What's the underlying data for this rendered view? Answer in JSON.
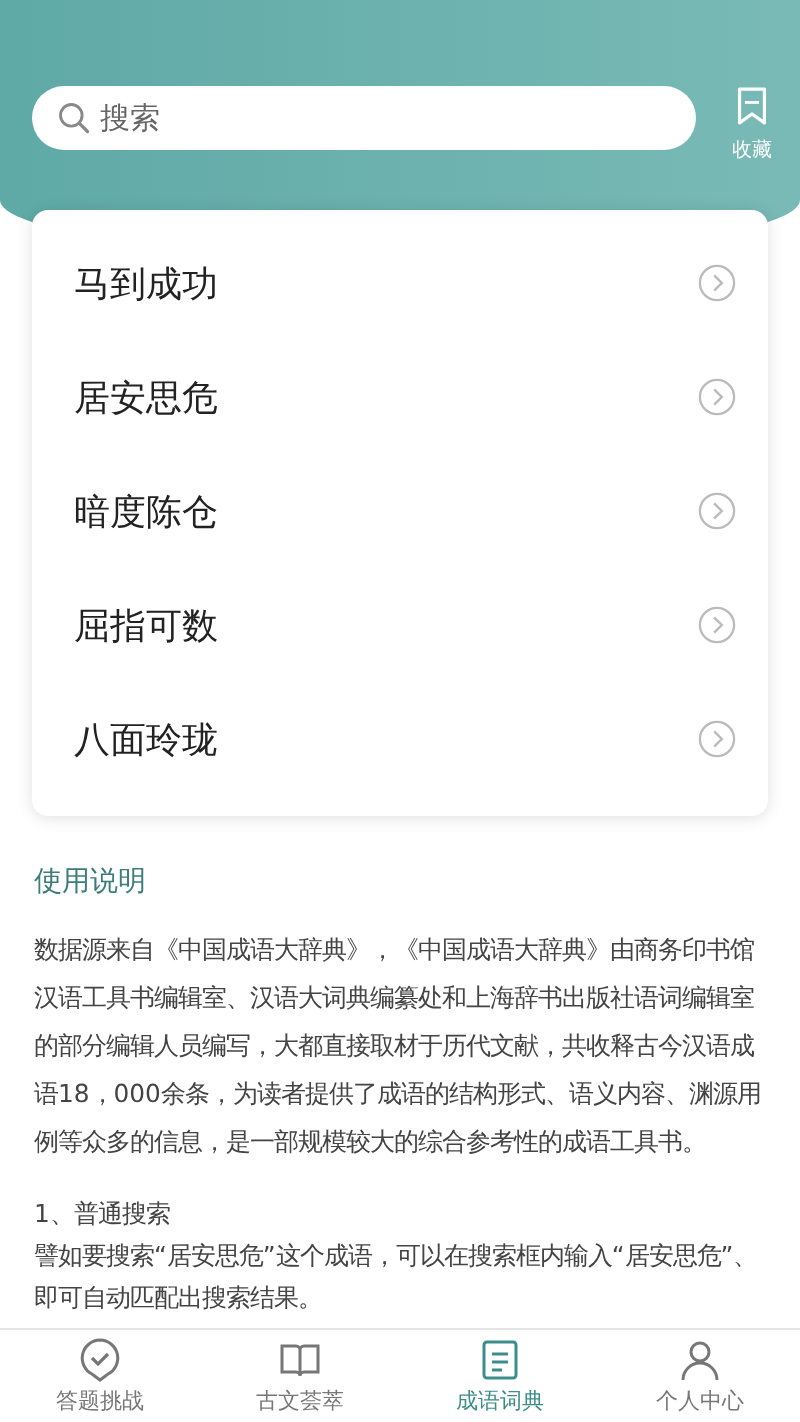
{
  "search": {
    "placeholder": "搜索"
  },
  "favorites": {
    "label": "收藏"
  },
  "idioms": [
    {
      "text": "马到成功"
    },
    {
      "text": "居安思危"
    },
    {
      "text": "暗度陈仓"
    },
    {
      "text": "屈指可数"
    },
    {
      "text": "八面玲珑"
    }
  ],
  "instructions": {
    "title": "使用说明",
    "intro": "数据源来自《中国成语大辞典》，《中国成语大辞典》由商务印书馆汉语工具书编辑室、汉语大词典编纂处和上海辞书出版社语词编辑室的部分编辑人员编写，大都直接取材于历代文献，共收释古今汉语成语18，000余条，为读者提供了成语的结构形式、语义内容、渊源用例等众多的信息，是一部规模较大的综合参考性的成语工具书。",
    "section_title": "1、普通搜索",
    "section_text": "譬如要搜索“居安思危”这个成语，可以在搜索框内输入“居安思危”、即可自动匹配出搜索结果。"
  },
  "tabs": [
    {
      "label": "答题挑战",
      "kind": "check",
      "selected": false
    },
    {
      "label": "古文荟萃",
      "kind": "book",
      "selected": false
    },
    {
      "label": "成语词典",
      "kind": "dict",
      "selected": true
    },
    {
      "label": "个人中心",
      "kind": "person",
      "selected": false
    }
  ]
}
